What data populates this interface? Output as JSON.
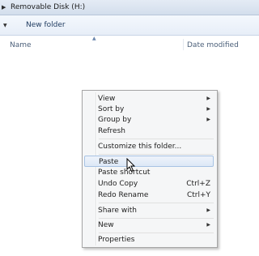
{
  "address": {
    "location": "Removable Disk (H:)"
  },
  "toolbar": {
    "new_folder": "New folder"
  },
  "columns": {
    "name": "Name",
    "date_modified": "Date modified"
  },
  "menu": {
    "view": "View",
    "sort_by": "Sort by",
    "group_by": "Group by",
    "refresh": "Refresh",
    "customize": "Customize this folder...",
    "paste": "Paste",
    "paste_shortcut": "Paste shortcut",
    "undo_copy": "Undo Copy",
    "undo_copy_key": "Ctrl+Z",
    "redo_rename": "Redo Rename",
    "redo_rename_key": "Ctrl+Y",
    "share_with": "Share with",
    "new": "New",
    "properties": "Properties"
  }
}
